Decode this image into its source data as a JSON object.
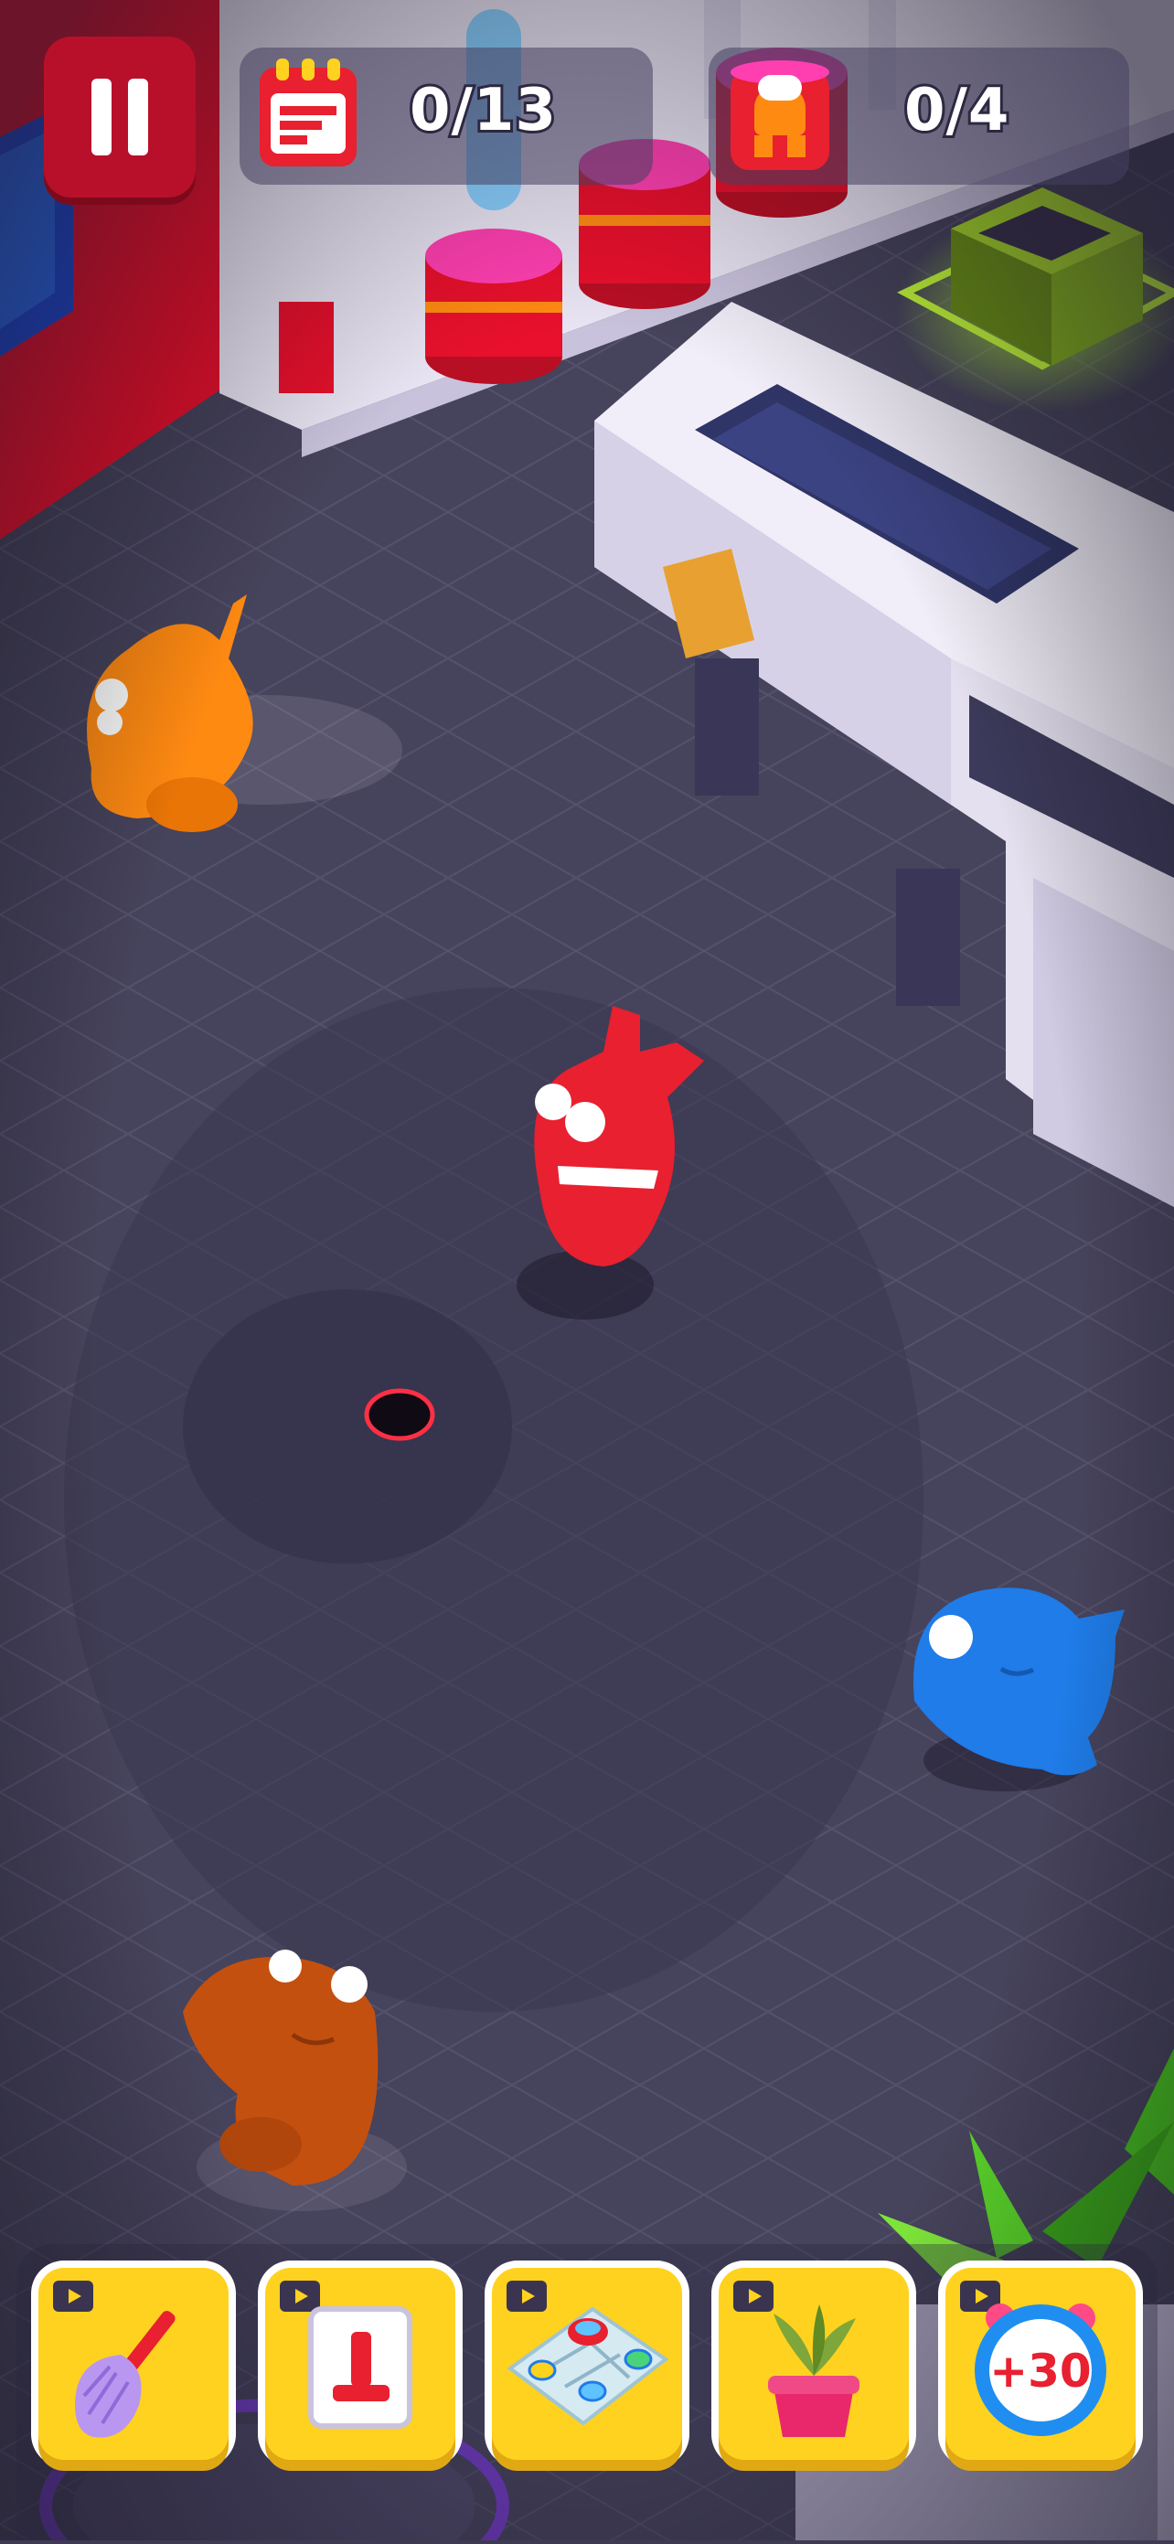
{
  "hud": {
    "tasks_progress": "0/13",
    "rescued_progress": "0/4",
    "icons": {
      "pause": "pause-icon",
      "tasks": "calendar-list-icon",
      "rescued": "character-cup-icon"
    }
  },
  "characters": [
    {
      "name": "player",
      "color": "#e8202f"
    },
    {
      "name": "orange-blob",
      "color": "#ff8a12"
    },
    {
      "name": "blue-blob",
      "color": "#1f7ce8"
    },
    {
      "name": "brown-blob",
      "color": "#c4500f"
    }
  ],
  "toolbar": {
    "items": [
      {
        "icon": "feather-duster-icon",
        "ad_icon": "video-ad-icon"
      },
      {
        "icon": "switch-icon",
        "ad_icon": "video-ad-icon"
      },
      {
        "icon": "map-icon",
        "ad_icon": "video-ad-icon"
      },
      {
        "icon": "potted-plant-icon",
        "ad_icon": "video-ad-icon"
      },
      {
        "icon": "time-bonus-icon",
        "label": "+30",
        "ad_icon": "video-ad-icon"
      }
    ]
  },
  "colors": {
    "floor": "#46435c",
    "accent_red": "#e8202f",
    "button_yellow": "#ffd21f"
  }
}
